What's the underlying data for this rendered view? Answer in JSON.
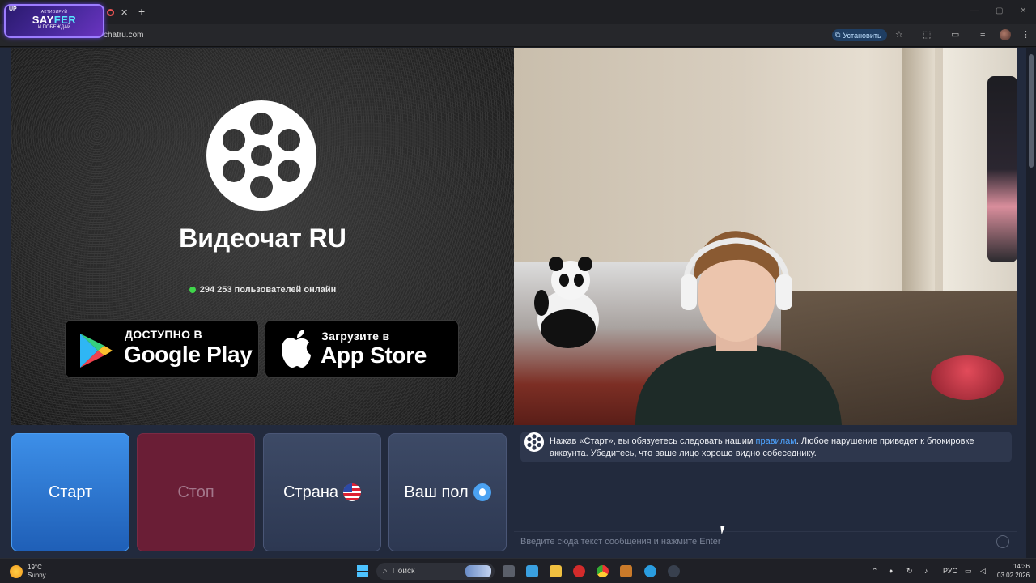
{
  "browser": {
    "badge": {
      "tag": "UP",
      "small": "АКТИВИРУЙ",
      "title_a": "SAY",
      "title_b": "FER",
      "sub": "И ПОБЕЖДАЙ"
    },
    "url": "chatru.com",
    "install_label": "Установить"
  },
  "left_panel": {
    "brand_title": "Видеочат RU",
    "online_text": "294 253 пользователей онлайн",
    "google_play": {
      "line1": "ДОСТУПНО В",
      "line2": "Google Play"
    },
    "app_store": {
      "line1": "Загрузите в",
      "line2": "App Store"
    }
  },
  "controls": {
    "start_label": "Старт",
    "stop_label": "Стоп",
    "country_label": "Страна",
    "gender_label": "Ваш пол"
  },
  "chat": {
    "system_before": "Нажав «Старт», вы обязуетесь следовать нашим ",
    "system_link": "правилам",
    "system_after": ". Любое нарушение приведет к блокировке аккаунта. Убедитесь, что ваше лицо хорошо видно собеседнику.",
    "input_placeholder": "Введите сюда текст сообщения и нажмите Enter"
  },
  "taskbar": {
    "temp": "19°C",
    "weather": "Sunny",
    "search_label": "Поиск",
    "lang": "РУС",
    "time": "14:36",
    "date": "03.02.2026"
  },
  "colors": {
    "start_btn": "#2f7bd8",
    "stop_btn": "#6a1e36",
    "panel_bg": "#222a3d",
    "online_dot": "#3fd64a",
    "link": "#4da3ff"
  }
}
